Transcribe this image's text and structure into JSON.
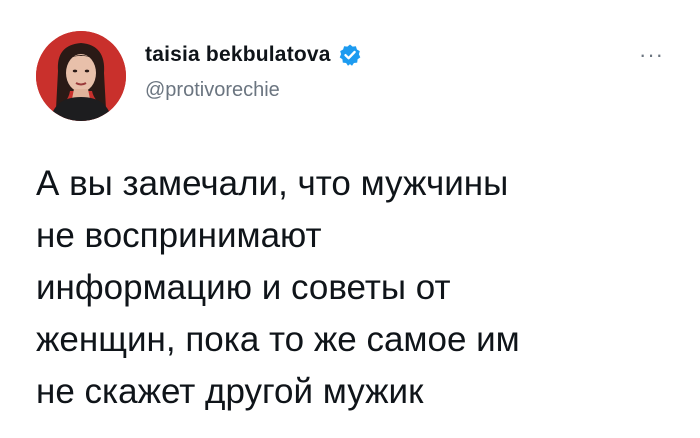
{
  "author": {
    "display_name": "taisia bekbulatova",
    "handle": "@protivorechie",
    "verified": true,
    "verified_icon": "verified-badge-icon",
    "avatar_icon": "profile-photo"
  },
  "more_icon": "more-options-icon",
  "more_glyph": "···",
  "tweet": {
    "text": "А вы замечали, что мужчины\nне воспринимают\nинформацию и советы от\nженщин, пока то же самое им\nне скажет другой мужик"
  },
  "colors": {
    "text": "#0f1419",
    "secondary": "#6b7580",
    "verified": "#1d9bf0",
    "avatar_bg": "#c9302c"
  }
}
